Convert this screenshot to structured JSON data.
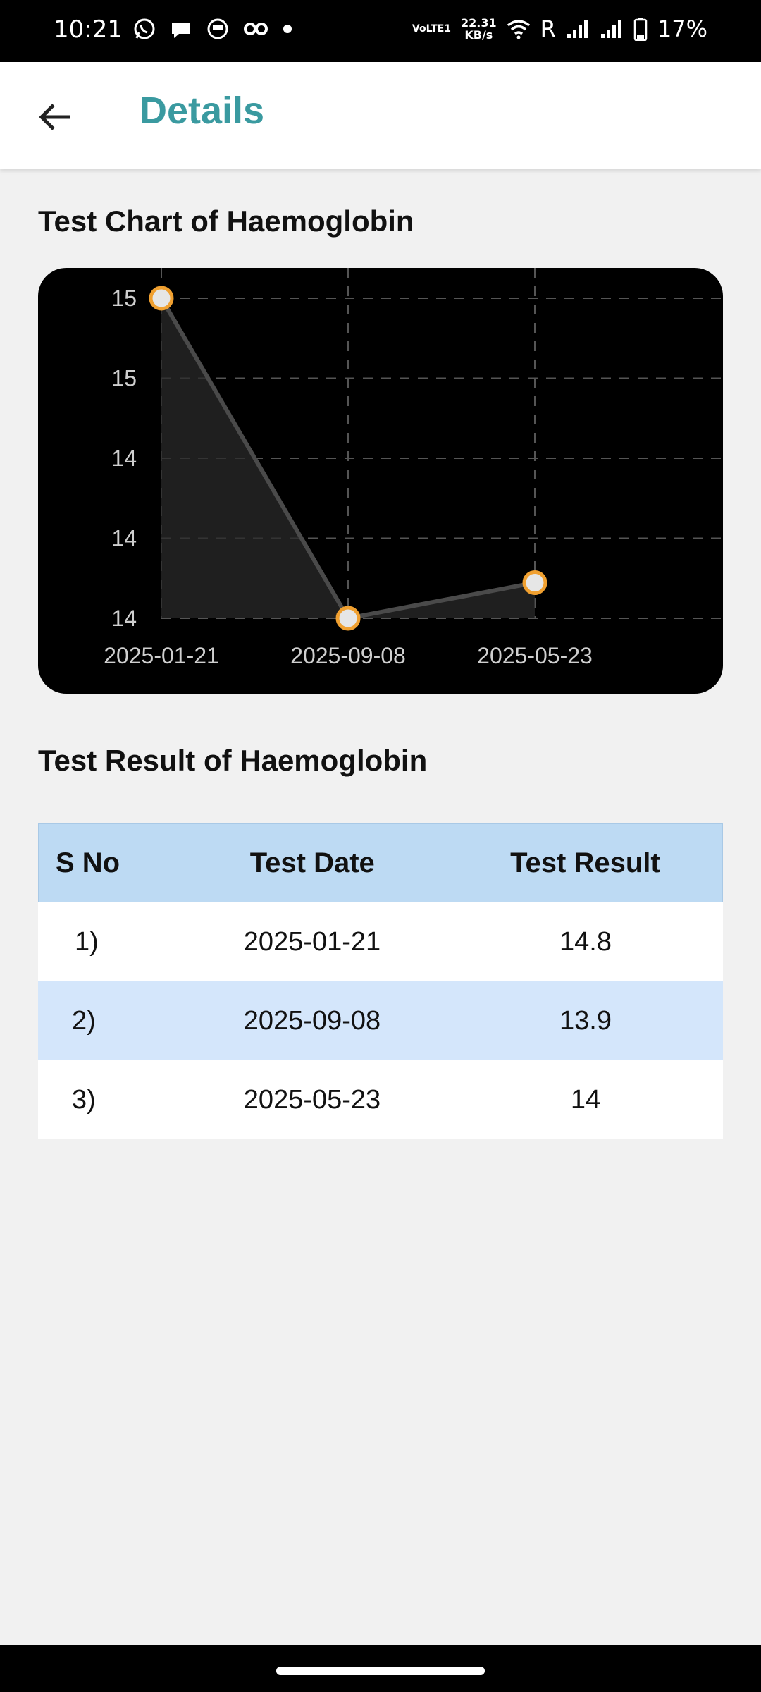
{
  "status_bar": {
    "time": "10:21",
    "network_tag": "VoLTE1",
    "speed": "22.31",
    "speed_unit": "KB/s",
    "roaming": "R",
    "battery": "17%",
    "icons": [
      "whatsapp-icon",
      "chat-icon",
      "app-icon",
      "glasses-icon",
      "dot-icon",
      "wifi-icon",
      "signal-icon",
      "battery-icon"
    ]
  },
  "header": {
    "title": "Details",
    "title_color": "#3a9aa0"
  },
  "chart_section": {
    "title": "Test Chart of Haemoglobin"
  },
  "chart_data": {
    "type": "line",
    "x": [
      "2025-01-21",
      "2025-09-08",
      "2025-05-23"
    ],
    "series": [
      {
        "values": [
          14.8,
          13.9,
          14
        ]
      }
    ],
    "y_tick_labels": [
      "15",
      "15",
      "14",
      "14",
      "14"
    ],
    "ylim": [
      13.9,
      14.8
    ],
    "grid": true,
    "line_color": "#4a4a4a",
    "marker_fill": "#e6e6e6",
    "marker_stroke": "#f0a030",
    "background": "#000000"
  },
  "table_section": {
    "title": "Test Result of Haemoglobin",
    "columns": [
      "S No",
      "Test Date",
      "Test Result"
    ],
    "rows": [
      {
        "sno": "1)",
        "date": "2025-01-21",
        "result": "14.8"
      },
      {
        "sno": "2)",
        "date": "2025-09-08",
        "result": "13.9"
      },
      {
        "sno": "3)",
        "date": "2025-05-23",
        "result": "14"
      }
    ]
  }
}
